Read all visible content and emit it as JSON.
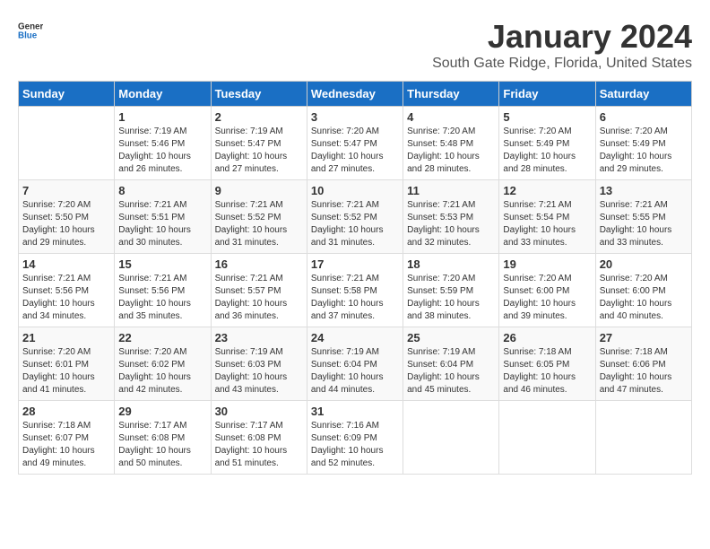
{
  "logo": {
    "general": "General",
    "blue": "Blue"
  },
  "title": "January 2024",
  "subtitle": "South Gate Ridge, Florida, United States",
  "days_of_week": [
    "Sunday",
    "Monday",
    "Tuesday",
    "Wednesday",
    "Thursday",
    "Friday",
    "Saturday"
  ],
  "weeks": [
    [
      {
        "day": "",
        "sunrise": "",
        "sunset": "",
        "daylight": ""
      },
      {
        "day": "1",
        "sunrise": "Sunrise: 7:19 AM",
        "sunset": "Sunset: 5:46 PM",
        "daylight": "Daylight: 10 hours and 26 minutes."
      },
      {
        "day": "2",
        "sunrise": "Sunrise: 7:19 AM",
        "sunset": "Sunset: 5:47 PM",
        "daylight": "Daylight: 10 hours and 27 minutes."
      },
      {
        "day": "3",
        "sunrise": "Sunrise: 7:20 AM",
        "sunset": "Sunset: 5:47 PM",
        "daylight": "Daylight: 10 hours and 27 minutes."
      },
      {
        "day": "4",
        "sunrise": "Sunrise: 7:20 AM",
        "sunset": "Sunset: 5:48 PM",
        "daylight": "Daylight: 10 hours and 28 minutes."
      },
      {
        "day": "5",
        "sunrise": "Sunrise: 7:20 AM",
        "sunset": "Sunset: 5:49 PM",
        "daylight": "Daylight: 10 hours and 28 minutes."
      },
      {
        "day": "6",
        "sunrise": "Sunrise: 7:20 AM",
        "sunset": "Sunset: 5:49 PM",
        "daylight": "Daylight: 10 hours and 29 minutes."
      }
    ],
    [
      {
        "day": "7",
        "sunrise": "Sunrise: 7:20 AM",
        "sunset": "Sunset: 5:50 PM",
        "daylight": "Daylight: 10 hours and 29 minutes."
      },
      {
        "day": "8",
        "sunrise": "Sunrise: 7:21 AM",
        "sunset": "Sunset: 5:51 PM",
        "daylight": "Daylight: 10 hours and 30 minutes."
      },
      {
        "day": "9",
        "sunrise": "Sunrise: 7:21 AM",
        "sunset": "Sunset: 5:52 PM",
        "daylight": "Daylight: 10 hours and 31 minutes."
      },
      {
        "day": "10",
        "sunrise": "Sunrise: 7:21 AM",
        "sunset": "Sunset: 5:52 PM",
        "daylight": "Daylight: 10 hours and 31 minutes."
      },
      {
        "day": "11",
        "sunrise": "Sunrise: 7:21 AM",
        "sunset": "Sunset: 5:53 PM",
        "daylight": "Daylight: 10 hours and 32 minutes."
      },
      {
        "day": "12",
        "sunrise": "Sunrise: 7:21 AM",
        "sunset": "Sunset: 5:54 PM",
        "daylight": "Daylight: 10 hours and 33 minutes."
      },
      {
        "day": "13",
        "sunrise": "Sunrise: 7:21 AM",
        "sunset": "Sunset: 5:55 PM",
        "daylight": "Daylight: 10 hours and 33 minutes."
      }
    ],
    [
      {
        "day": "14",
        "sunrise": "Sunrise: 7:21 AM",
        "sunset": "Sunset: 5:56 PM",
        "daylight": "Daylight: 10 hours and 34 minutes."
      },
      {
        "day": "15",
        "sunrise": "Sunrise: 7:21 AM",
        "sunset": "Sunset: 5:56 PM",
        "daylight": "Daylight: 10 hours and 35 minutes."
      },
      {
        "day": "16",
        "sunrise": "Sunrise: 7:21 AM",
        "sunset": "Sunset: 5:57 PM",
        "daylight": "Daylight: 10 hours and 36 minutes."
      },
      {
        "day": "17",
        "sunrise": "Sunrise: 7:21 AM",
        "sunset": "Sunset: 5:58 PM",
        "daylight": "Daylight: 10 hours and 37 minutes."
      },
      {
        "day": "18",
        "sunrise": "Sunrise: 7:20 AM",
        "sunset": "Sunset: 5:59 PM",
        "daylight": "Daylight: 10 hours and 38 minutes."
      },
      {
        "day": "19",
        "sunrise": "Sunrise: 7:20 AM",
        "sunset": "Sunset: 6:00 PM",
        "daylight": "Daylight: 10 hours and 39 minutes."
      },
      {
        "day": "20",
        "sunrise": "Sunrise: 7:20 AM",
        "sunset": "Sunset: 6:00 PM",
        "daylight": "Daylight: 10 hours and 40 minutes."
      }
    ],
    [
      {
        "day": "21",
        "sunrise": "Sunrise: 7:20 AM",
        "sunset": "Sunset: 6:01 PM",
        "daylight": "Daylight: 10 hours and 41 minutes."
      },
      {
        "day": "22",
        "sunrise": "Sunrise: 7:20 AM",
        "sunset": "Sunset: 6:02 PM",
        "daylight": "Daylight: 10 hours and 42 minutes."
      },
      {
        "day": "23",
        "sunrise": "Sunrise: 7:19 AM",
        "sunset": "Sunset: 6:03 PM",
        "daylight": "Daylight: 10 hours and 43 minutes."
      },
      {
        "day": "24",
        "sunrise": "Sunrise: 7:19 AM",
        "sunset": "Sunset: 6:04 PM",
        "daylight": "Daylight: 10 hours and 44 minutes."
      },
      {
        "day": "25",
        "sunrise": "Sunrise: 7:19 AM",
        "sunset": "Sunset: 6:04 PM",
        "daylight": "Daylight: 10 hours and 45 minutes."
      },
      {
        "day": "26",
        "sunrise": "Sunrise: 7:18 AM",
        "sunset": "Sunset: 6:05 PM",
        "daylight": "Daylight: 10 hours and 46 minutes."
      },
      {
        "day": "27",
        "sunrise": "Sunrise: 7:18 AM",
        "sunset": "Sunset: 6:06 PM",
        "daylight": "Daylight: 10 hours and 47 minutes."
      }
    ],
    [
      {
        "day": "28",
        "sunrise": "Sunrise: 7:18 AM",
        "sunset": "Sunset: 6:07 PM",
        "daylight": "Daylight: 10 hours and 49 minutes."
      },
      {
        "day": "29",
        "sunrise": "Sunrise: 7:17 AM",
        "sunset": "Sunset: 6:08 PM",
        "daylight": "Daylight: 10 hours and 50 minutes."
      },
      {
        "day": "30",
        "sunrise": "Sunrise: 7:17 AM",
        "sunset": "Sunset: 6:08 PM",
        "daylight": "Daylight: 10 hours and 51 minutes."
      },
      {
        "day": "31",
        "sunrise": "Sunrise: 7:16 AM",
        "sunset": "Sunset: 6:09 PM",
        "daylight": "Daylight: 10 hours and 52 minutes."
      },
      {
        "day": "",
        "sunrise": "",
        "sunset": "",
        "daylight": ""
      },
      {
        "day": "",
        "sunrise": "",
        "sunset": "",
        "daylight": ""
      },
      {
        "day": "",
        "sunrise": "",
        "sunset": "",
        "daylight": ""
      }
    ]
  ]
}
